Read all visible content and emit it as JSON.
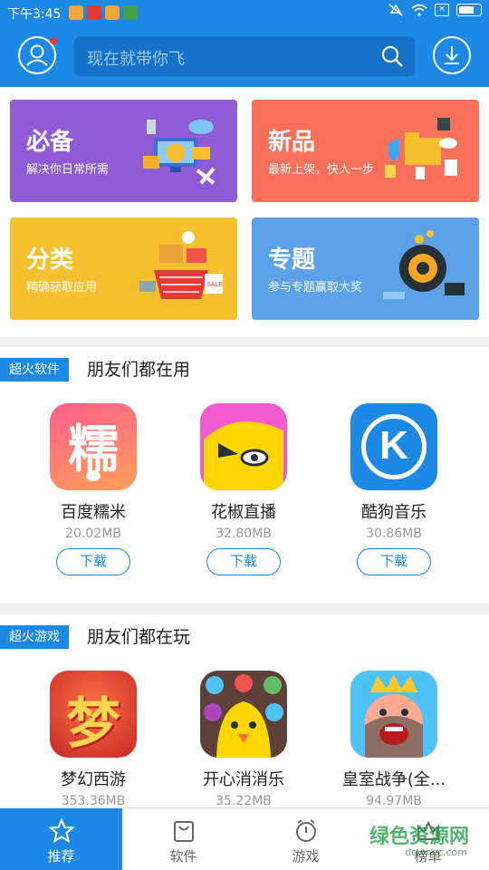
{
  "status": {
    "time": "下午3:45"
  },
  "header": {
    "search_placeholder": "现在就带你飞"
  },
  "cards": [
    {
      "title": "必备",
      "subtitle": "解决你日常所需",
      "color": "#8e5cd4"
    },
    {
      "title": "新品",
      "subtitle": "最新上架，快人一步",
      "color": "#f9705a"
    },
    {
      "title": "分类",
      "subtitle": "精确获取应用",
      "color": "#f6c02f"
    },
    {
      "title": "专题",
      "subtitle": "参与专题赢取大奖",
      "color": "#5ba2e8"
    }
  ],
  "software": {
    "tag": "超火软件",
    "title": "朋友们都在用",
    "apps": [
      {
        "name": "百度糯米",
        "size": "20.02MB",
        "button": "下载",
        "icon_text": "糯"
      },
      {
        "name": "花椒直播",
        "size": "32.80MB",
        "button": "下载"
      },
      {
        "name": "酷狗音乐",
        "size": "30.86MB",
        "button": "下载",
        "icon_text": "K"
      }
    ]
  },
  "games": {
    "tag": "超火游戏",
    "title": "朋友们都在玩",
    "apps": [
      {
        "name": "梦幻西游",
        "size": "353.36MB",
        "icon_text": "梦"
      },
      {
        "name": "开心消消乐",
        "size": "35.22MB"
      },
      {
        "name": "皇室战争(全...",
        "size": "94.97MB"
      }
    ]
  },
  "nav": [
    {
      "label": "推荐",
      "icon": "star-icon"
    },
    {
      "label": "软件",
      "icon": "bag-icon"
    },
    {
      "label": "游戏",
      "icon": "clock-icon"
    },
    {
      "label": "榜单",
      "icon": "crown-icon"
    }
  ],
  "watermark": {
    "main": "绿色资源网",
    "sub": "downcc.com"
  }
}
